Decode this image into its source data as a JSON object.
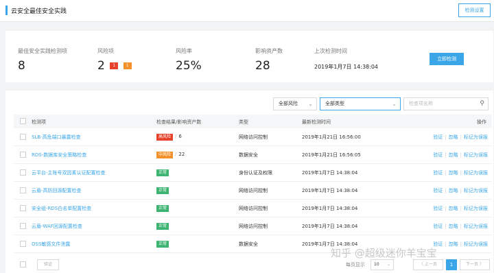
{
  "header": {
    "title": "云安全最佳安全实践",
    "settings_button": "检测设置"
  },
  "stats": {
    "items": [
      {
        "label": "最佳安全实践检测项",
        "value": "8"
      },
      {
        "label": "风险项",
        "value": "2",
        "badges": [
          {
            "text": "1",
            "color": "#e5412b"
          },
          {
            "text": "1",
            "color": "#f5912b"
          }
        ]
      },
      {
        "label": "风险率",
        "value": "25%"
      },
      {
        "label": "影响资产数",
        "value": "28"
      },
      {
        "label": "上次检测时间",
        "value": "2019年1月7日 14:38:04"
      }
    ],
    "detect_button": "立即检测"
  },
  "filters": {
    "risk": "全部风险",
    "type": "全部类型",
    "search_placeholder": "检查项名称"
  },
  "table": {
    "columns": [
      "检测项",
      "检查结果/影响资产数",
      "类型",
      "最新检测时间",
      "操作"
    ],
    "rows": [
      {
        "name": "SLB-高危端口暴露检查",
        "status": "高风险",
        "status_color": "#e5412b",
        "assets": "6",
        "type": "网络访问控制",
        "time": "2019年1月21日 16:56:00"
      },
      {
        "name": "RDS-数据库安全策略检查",
        "status": "中风险",
        "status_color": "#f5912b",
        "assets": "22",
        "type": "数据安全",
        "time": "2019年1月21日 16:56:05"
      },
      {
        "name": "云平台-主账号双因素认证配置检查",
        "status": "正常",
        "status_color": "#3cb371",
        "assets": "",
        "type": "身份认证及权限",
        "time": "2019年1月7日 14:38:04"
      },
      {
        "name": "云盾-高防回源配置检查",
        "status": "正常",
        "status_color": "#3cb371",
        "assets": "",
        "type": "网络访问控制",
        "time": "2019年1月7日 14:38:04"
      },
      {
        "name": "安全组-RDS白名单配置检查",
        "status": "正常",
        "status_color": "#3cb371",
        "assets": "",
        "type": "网络访问控制",
        "time": "2019年1月7日 14:38:04"
      },
      {
        "name": "云盾-WAF回源配置检查",
        "status": "正常",
        "status_color": "#3cb371",
        "assets": "",
        "type": "网络访问控制",
        "time": "2019年1月7日 14:38:04"
      },
      {
        "name": "OSS敏感文件泄露",
        "status": "正常",
        "status_color": "#3cb371",
        "assets": "",
        "type": "数据安全",
        "time": "2019年1月7日 14:38:04"
      }
    ],
    "actions": [
      "验证",
      "忽略",
      "标记为误报"
    ]
  },
  "footer": {
    "verify": "验证",
    "per_page_label": "每页显示",
    "per_page_value": "10",
    "prev": "〈 上一页",
    "current_page": "1",
    "next": "下一页 〉"
  },
  "watermark": "知乎 @超级迷你羊宝宝",
  "colors": {
    "accent": "#3aa6e8",
    "high": "#e5412b",
    "medium": "#f5912b",
    "normal": "#3cb371"
  }
}
